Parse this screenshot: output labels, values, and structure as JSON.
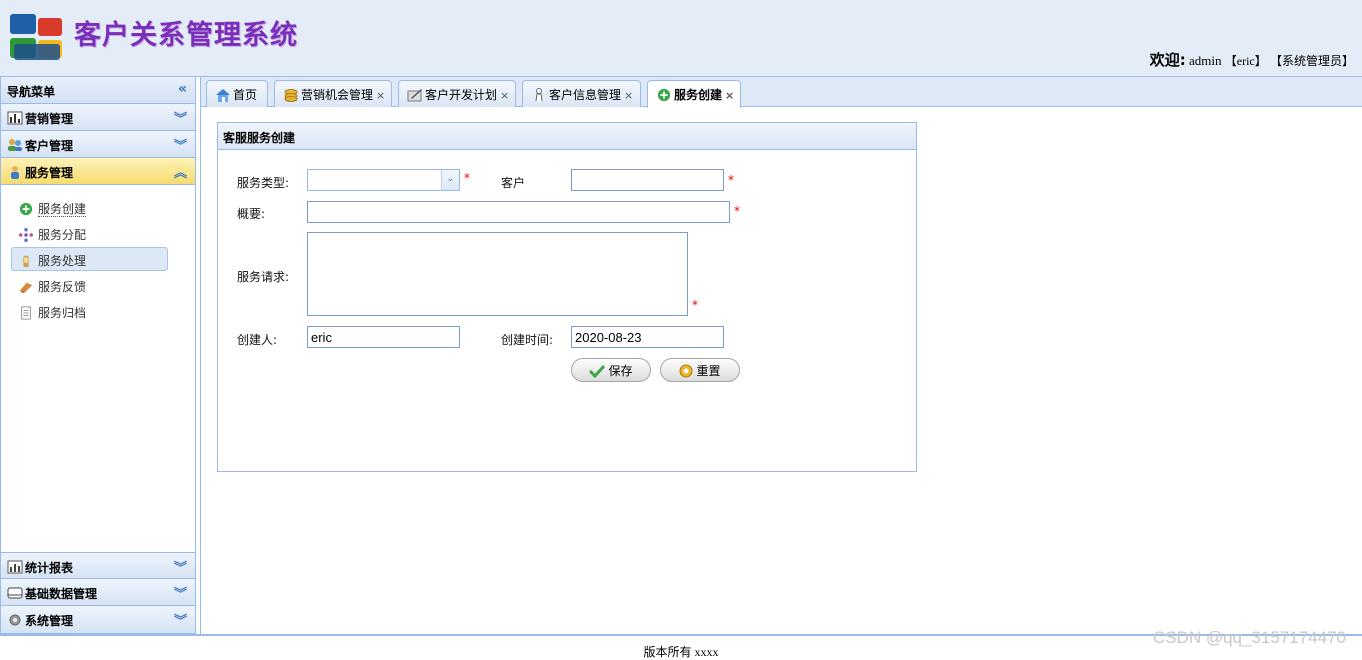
{
  "header": {
    "app_title": "客户关系管理系统",
    "welcome_label": "欢迎:",
    "username": "admin",
    "user_account": "【eric】",
    "user_role": "【系统管理员】"
  },
  "sidebar": {
    "title": "导航菜单",
    "collapse_symbol": "«",
    "sections": [
      {
        "label": "营销管理",
        "icon": "chart-icon",
        "chev": "⌄"
      },
      {
        "label": "客户管理",
        "icon": "users-icon",
        "chev": "⌄"
      },
      {
        "label": "服务管理",
        "icon": "service-icon",
        "chev": "⌃"
      }
    ],
    "service_items": [
      {
        "label": "服务创建",
        "icon": "add-circle-icon"
      },
      {
        "label": "服务分配",
        "icon": "assign-icon"
      },
      {
        "label": "服务处理",
        "icon": "process-icon"
      },
      {
        "label": "服务反馈",
        "icon": "feedback-icon"
      },
      {
        "label": "服务归档",
        "icon": "archive-icon"
      }
    ],
    "bottom_sections": [
      {
        "label": "统计报表",
        "icon": "report-icon"
      },
      {
        "label": "基础数据管理",
        "icon": "database-icon"
      },
      {
        "label": "系统管理",
        "icon": "gear-icon"
      }
    ]
  },
  "tabs": [
    {
      "label": "首页",
      "icon": "home-icon",
      "closable": false
    },
    {
      "label": "营销机会管理",
      "icon": "coins-icon",
      "closable": true
    },
    {
      "label": "客户开发计划",
      "icon": "plan-icon",
      "closable": true
    },
    {
      "label": "客户信息管理",
      "icon": "person-icon",
      "closable": true
    },
    {
      "label": "服务创建",
      "icon": "add-circle-icon",
      "closable": true,
      "active": true
    }
  ],
  "close_symbol": "×",
  "form": {
    "panel_title": "客服服务创建",
    "service_type_label": "服务类型:",
    "service_type_value": "",
    "customer_label": "客户",
    "customer_value": "",
    "summary_label": "概要:",
    "summary_value": "",
    "request_label": "服务请求:",
    "request_value": "",
    "creator_label": "创建人:",
    "creator_value": "eric",
    "create_time_label": "创建时间:",
    "create_time_value": "2020-08-23",
    "required_mark": "*",
    "save_button": "保存",
    "reset_button": "重置"
  },
  "footer": {
    "copyright": "版本所有 xxxx"
  },
  "watermark": "CSDN @qq_3157174470",
  "colors": {
    "border": "#99bbe8",
    "header_bg": "#e4ecf7",
    "title": "#7a2fb8",
    "active_section": "#f6dc6e"
  }
}
